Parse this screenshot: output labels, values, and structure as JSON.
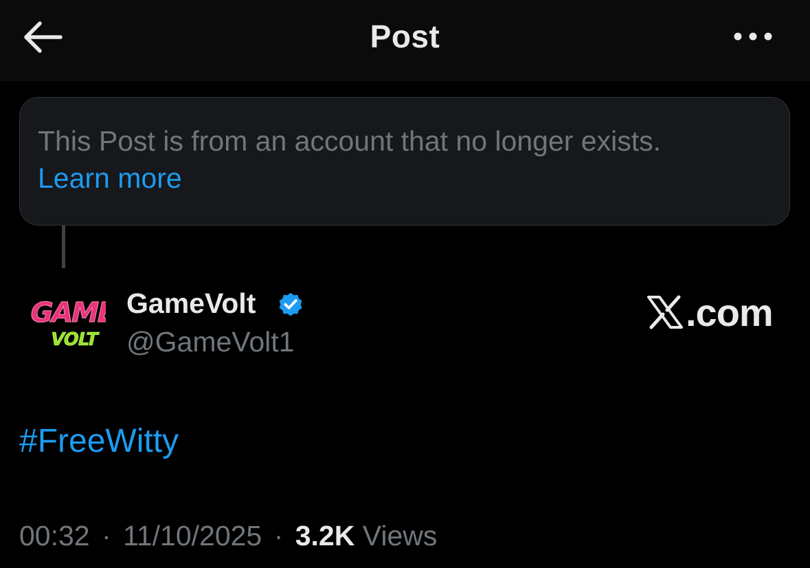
{
  "header": {
    "title": "Post",
    "back_icon": "arrow-left-icon",
    "more_icon": "more-horizontal-icon"
  },
  "notice": {
    "text": "This Post is from an account that no longer exists.",
    "link": "Learn more"
  },
  "post": {
    "avatar_text_top": "GAME",
    "avatar_text_bottom": "VOLT",
    "author_name": "GameVolt",
    "verified_icon": "verified-badge-icon",
    "handle": "@GameVolt1",
    "source_label": ".com",
    "source_icon": "x-logo-icon",
    "body": "#FreeWitty",
    "time": "00:32",
    "separator": "·",
    "date": "11/10/2025",
    "views_count": "3.2K",
    "views_label": "Views"
  },
  "colors": {
    "background": "#000000",
    "header_bg": "#0b0b0b",
    "notice_bg": "#16181c",
    "accent_blue": "#1d9bf0",
    "muted_text": "#71767b",
    "primary_text": "#e7e9ea",
    "avatar_pink": "#e8337a",
    "avatar_green": "#9be32c"
  }
}
